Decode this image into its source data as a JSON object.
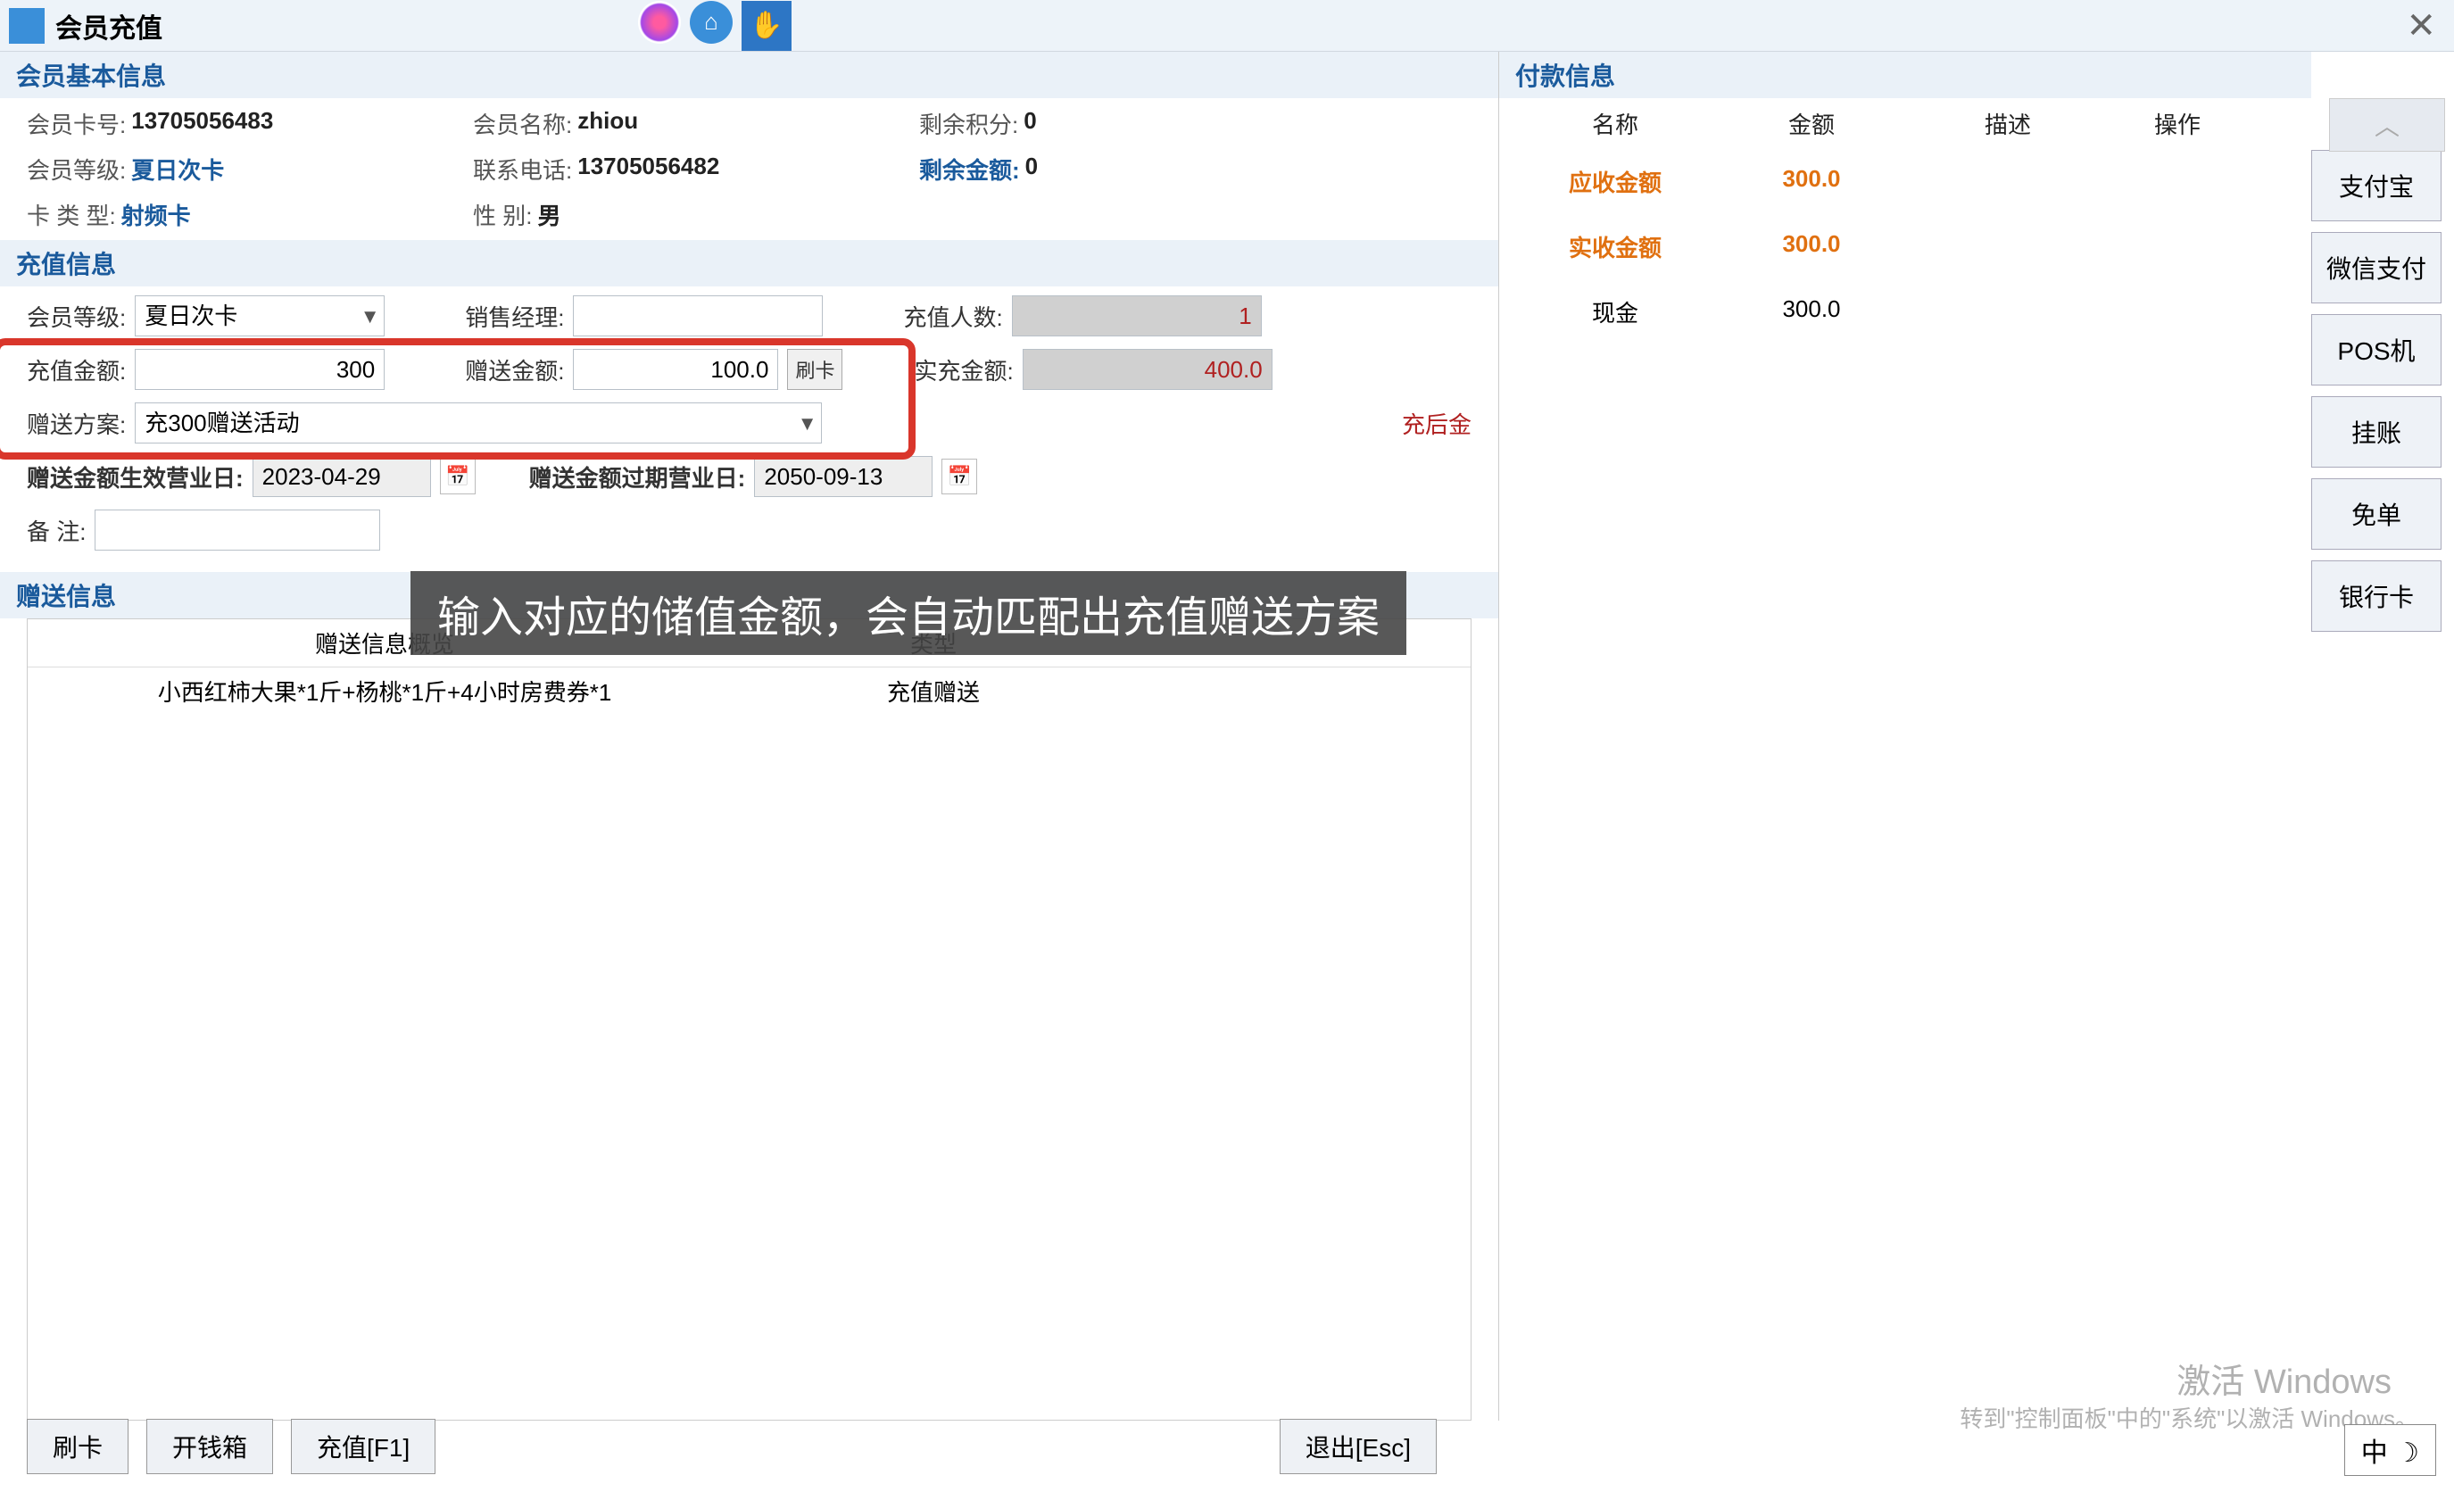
{
  "title": "会员充值",
  "member_section_title": "会员基本信息",
  "recharge_section_title": "充值信息",
  "gift_section_title": "赠送信息",
  "payment_section_title": "付款信息",
  "member": {
    "card_no_label": "会员卡号:",
    "card_no": "13705056483",
    "name_label": "会员名称:",
    "name": "zhiou",
    "points_label": "剩余积分:",
    "points": "0",
    "level_label": "会员等级:",
    "level": "夏日次卡",
    "phone_label": "联系电话:",
    "phone": "13705056482",
    "balance_label": "剩余金额:",
    "balance": "0",
    "card_type_label": "卡 类 型:",
    "card_type": "射频卡",
    "gender_label": "性      别:",
    "gender": "男"
  },
  "recharge": {
    "level_label": "会员等级:",
    "level_value": "夏日次卡",
    "sales_mgr_label": "销售经理:",
    "sales_mgr_value": "",
    "people_label": "充值人数:",
    "people_value": "1",
    "amount_label": "充值金额:",
    "amount_value": "300",
    "gift_amount_label": "赠送金额:",
    "gift_amount_value": "100.0",
    "swipe_card_btn": "刷卡",
    "actual_label": "实充金额:",
    "actual_value": "400.0",
    "plan_label": "赠送方案:",
    "plan_value": "充300赠送活动",
    "effective_label": "赠送金额生效营业日:",
    "effective_value": "2023-04-29",
    "expire_label": "赠送金额过期营业日:",
    "expire_value": "2050-09-13",
    "remark_label": "备    注:",
    "remark_value": "",
    "after_amount_label": "充后金"
  },
  "gift_table": {
    "col1": "赠送信息概览",
    "col2": "类型",
    "row1": {
      "desc": "小西红柿大果*1斤+杨桃*1斤+4小时房费券*1",
      "type": "充值赠送"
    }
  },
  "payment": {
    "col_name": "名称",
    "col_amount": "金额",
    "col_desc": "描述",
    "col_action": "操作",
    "rows": [
      {
        "name": "应收金额",
        "amount": "300.0",
        "highlight": true
      },
      {
        "name": "实收金额",
        "amount": "300.0",
        "highlight": true
      },
      {
        "name": "现金",
        "amount": "300.0",
        "highlight": false
      }
    ]
  },
  "pay_methods": [
    "支付宝",
    "微信支付",
    "POS机",
    "挂账",
    "免单",
    "银行卡"
  ],
  "bottom_buttons": {
    "swipe": "刷卡",
    "open_drawer": "开钱箱",
    "recharge": "充值[F1]",
    "exit": "退出[Esc]"
  },
  "subtitle": "输入对应的储值金额，会自动匹配出充值赠送方案",
  "watermark": "激活 Windows",
  "watermark_sub": "转到\"控制面板\"中的\"系统\"以激活 Windows。",
  "ime": "中 ☽"
}
